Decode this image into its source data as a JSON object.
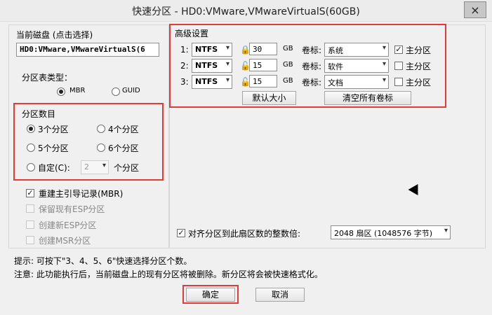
{
  "window": {
    "title": "快速分区 - HD0:VMware,VMwareVirtualS(60GB)",
    "close_icon": "×"
  },
  "current_disk": {
    "label": "当前磁盘 (点击选择)",
    "value": "HD0:VMware,VMwareVirtualS(6"
  },
  "partition_table": {
    "label": "分区表类型：",
    "mbr": "MBR",
    "guid": "GUID",
    "selected": "MBR"
  },
  "partition_count": {
    "label": "分区数目",
    "options": [
      "3个分区",
      "4个分区",
      "5个分区",
      "6个分区"
    ],
    "custom_label": "自定(C):",
    "custom_value": "2",
    "custom_suffix": "个分区",
    "selected": "3个分区"
  },
  "options": {
    "rebuild_mbr": "重建主引导记录(MBR)",
    "keep_esp": "保留现有ESP分区",
    "create_esp": "创建新ESP分区",
    "create_msr": "创建MSR分区"
  },
  "advanced": {
    "label": "高级设置",
    "rows": [
      {
        "index": "1:",
        "fs": "NTFS",
        "size": "30",
        "unit": "GB",
        "volume_label": "卷标:",
        "volume": "系统",
        "primary_label": "主分区",
        "primary_checked": true
      },
      {
        "index": "2:",
        "fs": "NTFS",
        "size": "15",
        "unit": "GB",
        "volume_label": "卷标:",
        "volume": "软件",
        "primary_label": "主分区",
        "primary_checked": false
      },
      {
        "index": "3:",
        "fs": "NTFS",
        "size": "15",
        "unit": "GB",
        "volume_label": "卷标:",
        "volume": "文档",
        "primary_label": "主分区",
        "primary_checked": false
      }
    ],
    "default_size_button": "默认大小",
    "clear_labels_button": "清空所有卷标"
  },
  "alignment": {
    "label": "对齐分区到此扇区数的整数倍:",
    "value": "2048 扇区 (1048576 字节)"
  },
  "notes": {
    "tip": "提示: 可按下\"3、4、5、6\"快速选择分区个数。",
    "warning": "注意: 此功能执行后，当前磁盘上的现有分区将被删除。新分区将会被快速格式化。"
  },
  "buttons": {
    "ok": "确定",
    "cancel": "取消"
  }
}
